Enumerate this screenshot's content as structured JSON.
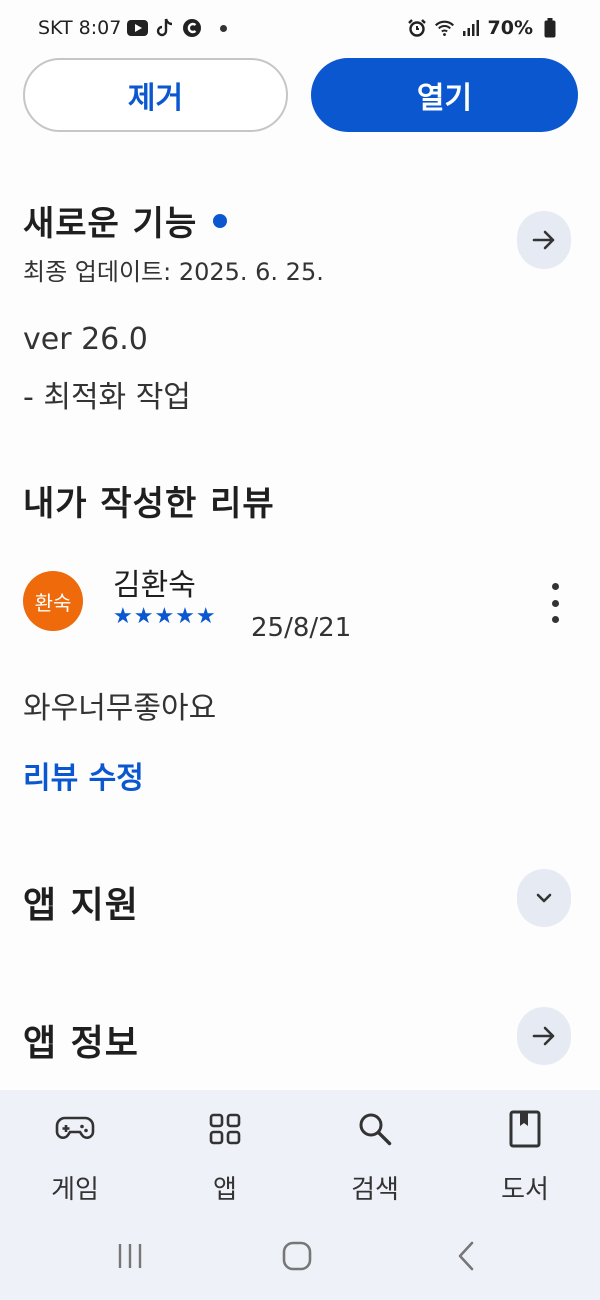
{
  "status_bar": {
    "carrier": "SKT",
    "time": "8:07",
    "battery": "70%"
  },
  "actions": {
    "remove_label": "제거",
    "open_label": "열기"
  },
  "whats_new": {
    "title": "새로운 기능",
    "updated": "최종 업데이트: 2025. 6. 25.",
    "version": "ver 26.0",
    "notes": "- 최적화 작업"
  },
  "my_review": {
    "title": "내가 작성한 리뷰",
    "avatar_text": "환숙",
    "avatar_color": "#ee6a0b",
    "reviewer": "김환숙",
    "rating": 5,
    "stars": "★★★★★",
    "date": "25/8/21",
    "text": "와우너무좋아요",
    "edit_label": "리뷰 수정"
  },
  "sections": {
    "app_support": "앱 지원",
    "app_info": "앱 정보"
  },
  "bottom_nav": {
    "items": [
      {
        "label": "게임",
        "icon": "gamepad-icon"
      },
      {
        "label": "앱",
        "icon": "apps-grid-icon"
      },
      {
        "label": "검색",
        "icon": "search-icon"
      },
      {
        "label": "도서",
        "icon": "book-icon"
      }
    ]
  },
  "colors": {
    "accent": "#0b57d0",
    "nav_background": "#eef1f7",
    "circle_button": "#e6ebf3"
  }
}
